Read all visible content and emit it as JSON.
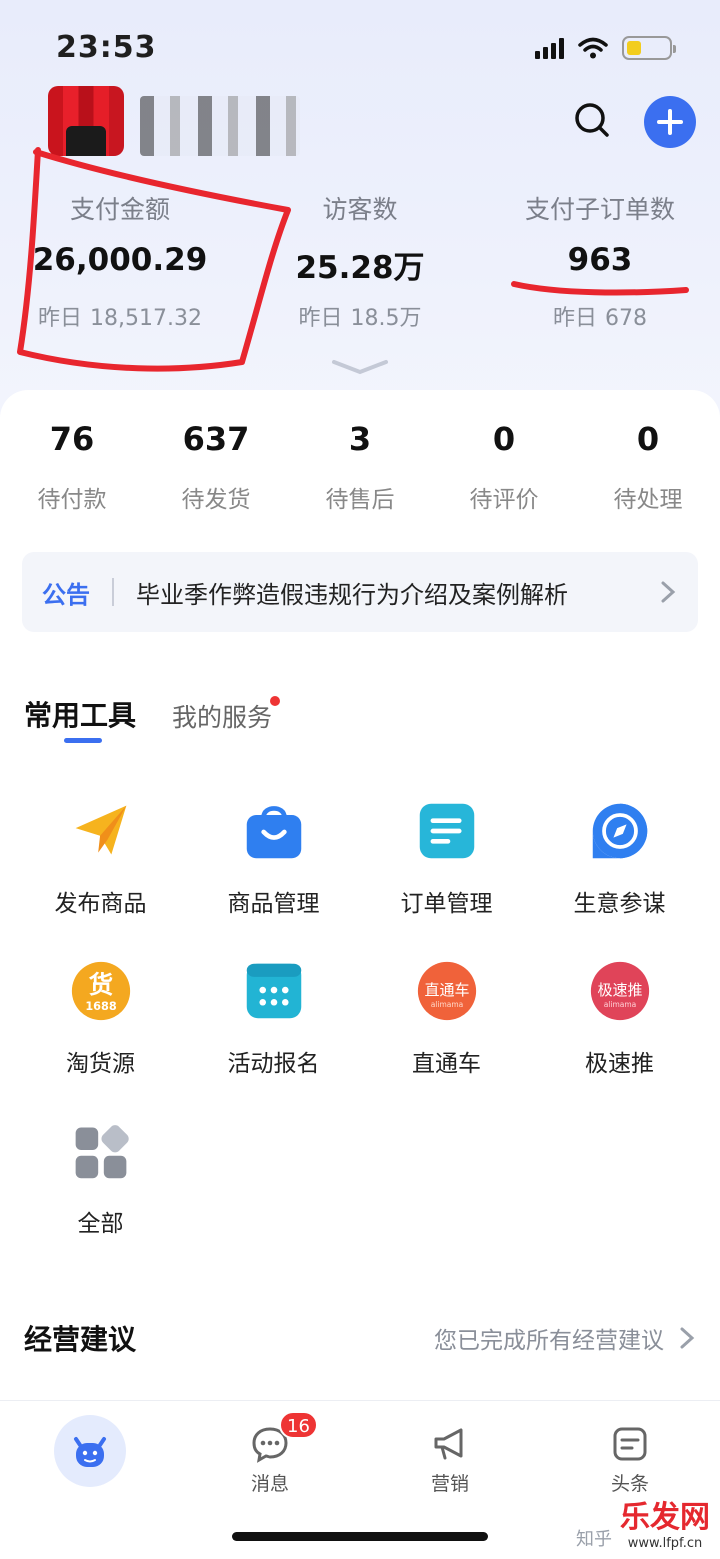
{
  "status_bar": {
    "time": "23:53"
  },
  "header": {
    "shop_name": ""
  },
  "metrics": [
    {
      "label": "支付金额",
      "value": "26,000.29",
      "yesterday_label": "昨日",
      "yesterday_value": "18,517.32"
    },
    {
      "label": "访客数",
      "value": "25.28万",
      "yesterday_label": "昨日",
      "yesterday_value": "18.5万"
    },
    {
      "label": "支付子订单数",
      "value": "963",
      "yesterday_label": "昨日",
      "yesterday_value": "678"
    }
  ],
  "order_status": [
    {
      "count": "76",
      "label": "待付款"
    },
    {
      "count": "637",
      "label": "待发货"
    },
    {
      "count": "3",
      "label": "待售后"
    },
    {
      "count": "0",
      "label": "待评价"
    },
    {
      "count": "0",
      "label": "待处理"
    }
  ],
  "notice": {
    "tag": "公告",
    "text": "毕业季作弊造假违规行为介绍及案例解析"
  },
  "tabs": {
    "active": "常用工具",
    "other": "我的服务"
  },
  "tools": [
    {
      "label": "发布商品",
      "icon": "paper-plane-icon"
    },
    {
      "label": "商品管理",
      "icon": "shopping-bag-icon"
    },
    {
      "label": "订单管理",
      "icon": "document-list-icon"
    },
    {
      "label": "生意参谋",
      "icon": "compass-icon"
    },
    {
      "label": "淘货源",
      "icon": "huo-1688-icon",
      "icon_text": "货",
      "icon_subtext": "1688"
    },
    {
      "label": "活动报名",
      "icon": "calendar-icon"
    },
    {
      "label": "直通车",
      "icon": "ztc-alimama-icon",
      "icon_text": "直通车",
      "icon_subtext": "alimama"
    },
    {
      "label": "极速推",
      "icon": "jst-alimama-icon",
      "icon_text": "极速推",
      "icon_subtext": "alimama"
    },
    {
      "label": "全部",
      "icon": "grid-all-icon"
    }
  ],
  "advice": {
    "title": "经营建议",
    "status": "您已完成所有经营建议"
  },
  "bottom_nav": {
    "messages": {
      "label": "消息",
      "badge": "16"
    },
    "marketing": {
      "label": "营销"
    },
    "headlines": {
      "label": "头条"
    }
  },
  "watermark": {
    "text": "知乎",
    "logo": "乐发网",
    "url": "www.lfpf.cn"
  },
  "colors": {
    "accent": "#3b6ff0",
    "badge": "#ee3434",
    "annotation": "#e8262e"
  }
}
